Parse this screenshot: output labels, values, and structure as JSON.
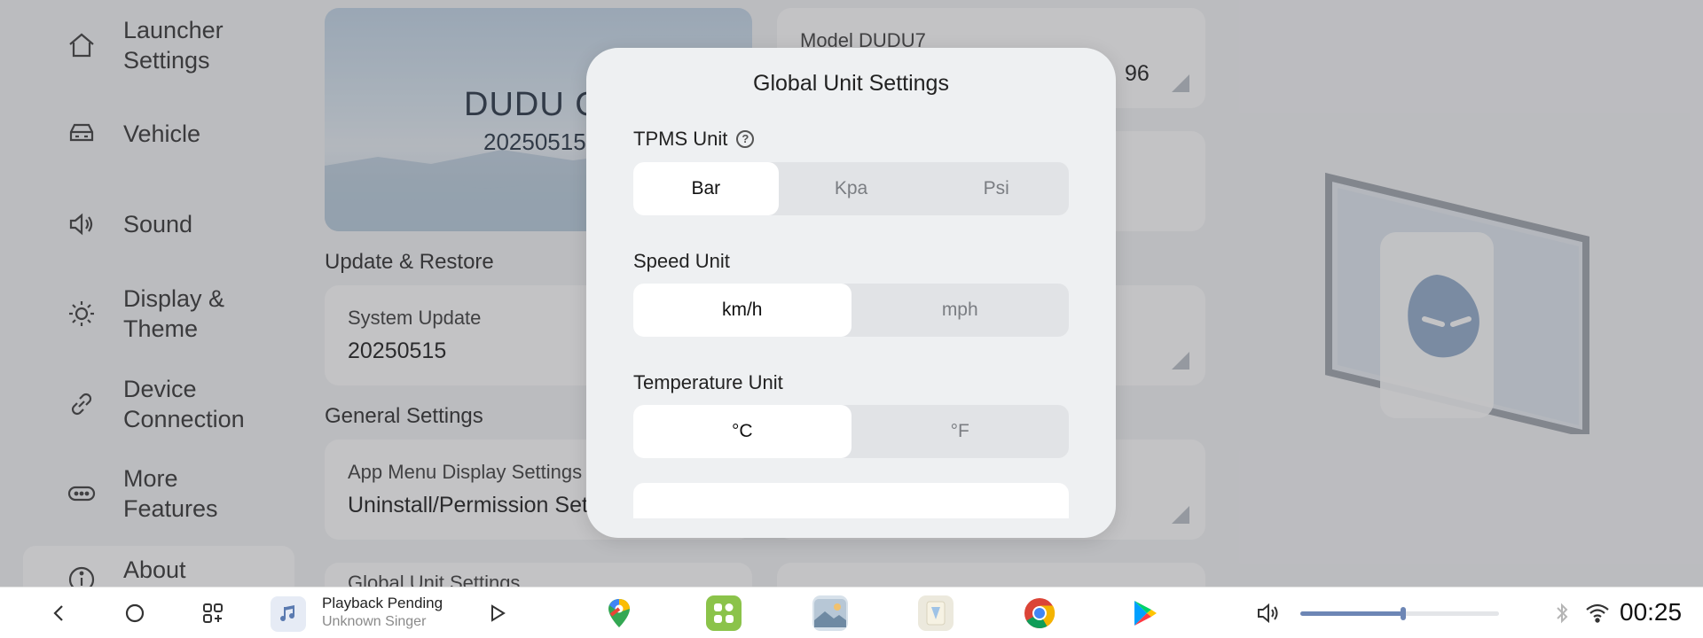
{
  "sidebar": {
    "items": [
      {
        "label": "Launcher\nSettings",
        "icon": "home-icon"
      },
      {
        "label": "Vehicle",
        "icon": "car-icon"
      },
      {
        "label": "Sound",
        "icon": "speaker-icon"
      },
      {
        "label": "Display &\nTheme",
        "icon": "sun-icon"
      },
      {
        "label": "Device\nConnection",
        "icon": "link-icon"
      },
      {
        "label": "More\nFeatures",
        "icon": "more-icon"
      },
      {
        "label": "About",
        "icon": "info-icon"
      }
    ]
  },
  "main": {
    "banner_title": "DUDU O",
    "banner_version": "20250515",
    "model_label": "Model  DUDU7",
    "model_value": "96",
    "update_section": "Update & Restore",
    "system_update_label": "System Update",
    "system_update_value": "20250515",
    "general_section": "General Settings",
    "app_menu_label": "App Menu Display Settings",
    "app_menu_value": "Uninstall/Permission Sett",
    "global_unit_label": "Global Unit Settings"
  },
  "dialog": {
    "title": "Global Unit Settings",
    "tpms": {
      "label": "TPMS Unit",
      "options": [
        "Bar",
        "Kpa",
        "Psi"
      ],
      "selected": "Bar"
    },
    "speed": {
      "label": "Speed Unit",
      "options": [
        "km/h",
        "mph"
      ],
      "selected": "km/h"
    },
    "temperature": {
      "label": "Temperature Unit",
      "options": [
        "°C",
        "°F"
      ],
      "selected": "°C"
    }
  },
  "bottombar": {
    "track": "Playback Pending",
    "artist": "Unknown Singer",
    "apps": [
      "maps-icon",
      "widgets-app-icon",
      "gallery-icon",
      "photos-app-icon",
      "chrome-icon",
      "play-store-icon"
    ],
    "volume_fraction": 0.52,
    "clock": "00:25"
  },
  "colors": {
    "accent": "#6d86b5",
    "dialog_bg": "#eef0f2",
    "overlay": "#5a5a5f"
  }
}
